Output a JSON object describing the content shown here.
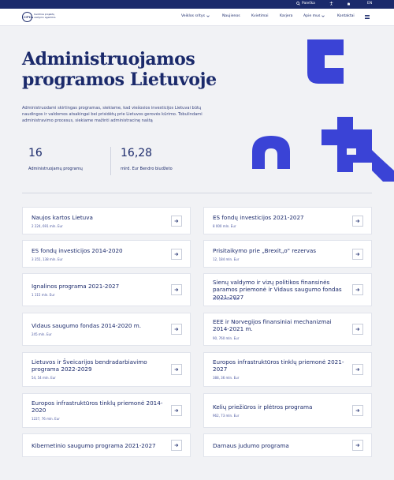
{
  "topbar": {
    "search_label": "Paieška",
    "lang_label": "EN"
  },
  "logo": {
    "abbr": "CPVA",
    "text": "Centrinė projektų valdymo agentūra"
  },
  "nav": {
    "items": [
      {
        "label": "Veiklos sritys"
      },
      {
        "label": "Naujienos"
      },
      {
        "label": "Kvietimai"
      },
      {
        "label": "Karjera"
      },
      {
        "label": "Apie mus"
      },
      {
        "label": "Kontaktai"
      }
    ]
  },
  "hero": {
    "title_line1": "Administruojamos",
    "title_line2": "programos Lietuvoje",
    "description": "Administruodami skirtingas programas, siekiame, kad viešosios investicijos Lietuvai būtų naudingos ir valdomos atsakingai bei prisidėtų prie Lietuvos gerovės kūrimo. Tobulindami administravimo procesus, siekiame mažinti administracinę naštą"
  },
  "stats": [
    {
      "value": "16",
      "label": "Administruojamų programų"
    },
    {
      "value": "16,28",
      "label": "mlrd. Eur Bendro biudžeto"
    }
  ],
  "programs": [
    {
      "title": "Naujos kartos Lietuva",
      "amount": "2 224, 691 mln. Eur"
    },
    {
      "title": "ES fondų investicijos 2021-2027",
      "amount": "8 000 mln. Eur"
    },
    {
      "title": "ES fondų investicijos 2014-2020",
      "amount": "3 355, 138 mln. Eur"
    },
    {
      "title": "Prisitaikymo prie „Brexit„o\" rezervas",
      "amount": "12, 184 mln. Eur"
    },
    {
      "title": "Ignalinos programa 2021-2027",
      "amount": "1 115 mln. Eur"
    },
    {
      "title": "Sienų valdymo ir vizų politikos finansinės paramos priemonė ir Vidaus saugumo fondas 2021-2027",
      "amount": "370, 61 mln. Eur"
    },
    {
      "title": "Vidaus saugumo fondas 2014-2020 m.",
      "amount": "245 mln. Eur"
    },
    {
      "title": "EEE ir Norvegijos finansiniai mechanizmai 2014-2021 m.",
      "amount": "90, 760 mln. Eur"
    },
    {
      "title": "Lietuvos ir Šveicarijos bendradarbiavimo programa 2022-2029",
      "amount": "54, 54 mln. Eur"
    },
    {
      "title": "Europos infrastruktūros tinklų priemonė 2021-2027",
      "amount": "388, 36 mln. Eur"
    },
    {
      "title": "Europos infrastruktūros tinklų priemonė 2014-2020",
      "amount": "1227, 76 mln. Eur"
    },
    {
      "title": "Kelių priežiūros ir plėtros programa",
      "amount": "962, 73 mln. Eur"
    },
    {
      "title": "Kibernetinio saugumo programa 2021-2027",
      "amount": ""
    },
    {
      "title": "Darnaus judumo programa",
      "amount": ""
    }
  ],
  "colors": {
    "brand": "#1b2a6b",
    "accent": "#3a43d6"
  }
}
